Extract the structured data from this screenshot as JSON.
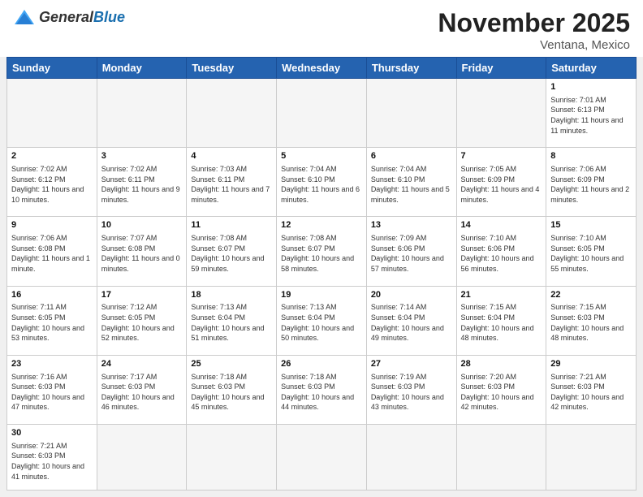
{
  "header": {
    "logo_general": "General",
    "logo_blue": "Blue",
    "month_title": "November 2025",
    "location": "Ventana, Mexico"
  },
  "days_of_week": [
    "Sunday",
    "Monday",
    "Tuesday",
    "Wednesday",
    "Thursday",
    "Friday",
    "Saturday"
  ],
  "weeks": [
    [
      {
        "day": "",
        "info": ""
      },
      {
        "day": "",
        "info": ""
      },
      {
        "day": "",
        "info": ""
      },
      {
        "day": "",
        "info": ""
      },
      {
        "day": "",
        "info": ""
      },
      {
        "day": "",
        "info": ""
      },
      {
        "day": "1",
        "info": "Sunrise: 7:01 AM\nSunset: 6:13 PM\nDaylight: 11 hours and 11 minutes."
      }
    ],
    [
      {
        "day": "2",
        "info": "Sunrise: 7:02 AM\nSunset: 6:12 PM\nDaylight: 11 hours and 10 minutes."
      },
      {
        "day": "3",
        "info": "Sunrise: 7:02 AM\nSunset: 6:11 PM\nDaylight: 11 hours and 9 minutes."
      },
      {
        "day": "4",
        "info": "Sunrise: 7:03 AM\nSunset: 6:11 PM\nDaylight: 11 hours and 7 minutes."
      },
      {
        "day": "5",
        "info": "Sunrise: 7:04 AM\nSunset: 6:10 PM\nDaylight: 11 hours and 6 minutes."
      },
      {
        "day": "6",
        "info": "Sunrise: 7:04 AM\nSunset: 6:10 PM\nDaylight: 11 hours and 5 minutes."
      },
      {
        "day": "7",
        "info": "Sunrise: 7:05 AM\nSunset: 6:09 PM\nDaylight: 11 hours and 4 minutes."
      },
      {
        "day": "8",
        "info": "Sunrise: 7:06 AM\nSunset: 6:09 PM\nDaylight: 11 hours and 2 minutes."
      }
    ],
    [
      {
        "day": "9",
        "info": "Sunrise: 7:06 AM\nSunset: 6:08 PM\nDaylight: 11 hours and 1 minute."
      },
      {
        "day": "10",
        "info": "Sunrise: 7:07 AM\nSunset: 6:08 PM\nDaylight: 11 hours and 0 minutes."
      },
      {
        "day": "11",
        "info": "Sunrise: 7:08 AM\nSunset: 6:07 PM\nDaylight: 10 hours and 59 minutes."
      },
      {
        "day": "12",
        "info": "Sunrise: 7:08 AM\nSunset: 6:07 PM\nDaylight: 10 hours and 58 minutes."
      },
      {
        "day": "13",
        "info": "Sunrise: 7:09 AM\nSunset: 6:06 PM\nDaylight: 10 hours and 57 minutes."
      },
      {
        "day": "14",
        "info": "Sunrise: 7:10 AM\nSunset: 6:06 PM\nDaylight: 10 hours and 56 minutes."
      },
      {
        "day": "15",
        "info": "Sunrise: 7:10 AM\nSunset: 6:05 PM\nDaylight: 10 hours and 55 minutes."
      }
    ],
    [
      {
        "day": "16",
        "info": "Sunrise: 7:11 AM\nSunset: 6:05 PM\nDaylight: 10 hours and 53 minutes."
      },
      {
        "day": "17",
        "info": "Sunrise: 7:12 AM\nSunset: 6:05 PM\nDaylight: 10 hours and 52 minutes."
      },
      {
        "day": "18",
        "info": "Sunrise: 7:13 AM\nSunset: 6:04 PM\nDaylight: 10 hours and 51 minutes."
      },
      {
        "day": "19",
        "info": "Sunrise: 7:13 AM\nSunset: 6:04 PM\nDaylight: 10 hours and 50 minutes."
      },
      {
        "day": "20",
        "info": "Sunrise: 7:14 AM\nSunset: 6:04 PM\nDaylight: 10 hours and 49 minutes."
      },
      {
        "day": "21",
        "info": "Sunrise: 7:15 AM\nSunset: 6:04 PM\nDaylight: 10 hours and 48 minutes."
      },
      {
        "day": "22",
        "info": "Sunrise: 7:15 AM\nSunset: 6:03 PM\nDaylight: 10 hours and 48 minutes."
      }
    ],
    [
      {
        "day": "23",
        "info": "Sunrise: 7:16 AM\nSunset: 6:03 PM\nDaylight: 10 hours and 47 minutes."
      },
      {
        "day": "24",
        "info": "Sunrise: 7:17 AM\nSunset: 6:03 PM\nDaylight: 10 hours and 46 minutes."
      },
      {
        "day": "25",
        "info": "Sunrise: 7:18 AM\nSunset: 6:03 PM\nDaylight: 10 hours and 45 minutes."
      },
      {
        "day": "26",
        "info": "Sunrise: 7:18 AM\nSunset: 6:03 PM\nDaylight: 10 hours and 44 minutes."
      },
      {
        "day": "27",
        "info": "Sunrise: 7:19 AM\nSunset: 6:03 PM\nDaylight: 10 hours and 43 minutes."
      },
      {
        "day": "28",
        "info": "Sunrise: 7:20 AM\nSunset: 6:03 PM\nDaylight: 10 hours and 42 minutes."
      },
      {
        "day": "29",
        "info": "Sunrise: 7:21 AM\nSunset: 6:03 PM\nDaylight: 10 hours and 42 minutes."
      }
    ],
    [
      {
        "day": "30",
        "info": "Sunrise: 7:21 AM\nSunset: 6:03 PM\nDaylight: 10 hours and 41 minutes."
      },
      {
        "day": "",
        "info": ""
      },
      {
        "day": "",
        "info": ""
      },
      {
        "day": "",
        "info": ""
      },
      {
        "day": "",
        "info": ""
      },
      {
        "day": "",
        "info": ""
      },
      {
        "day": "",
        "info": ""
      }
    ]
  ]
}
